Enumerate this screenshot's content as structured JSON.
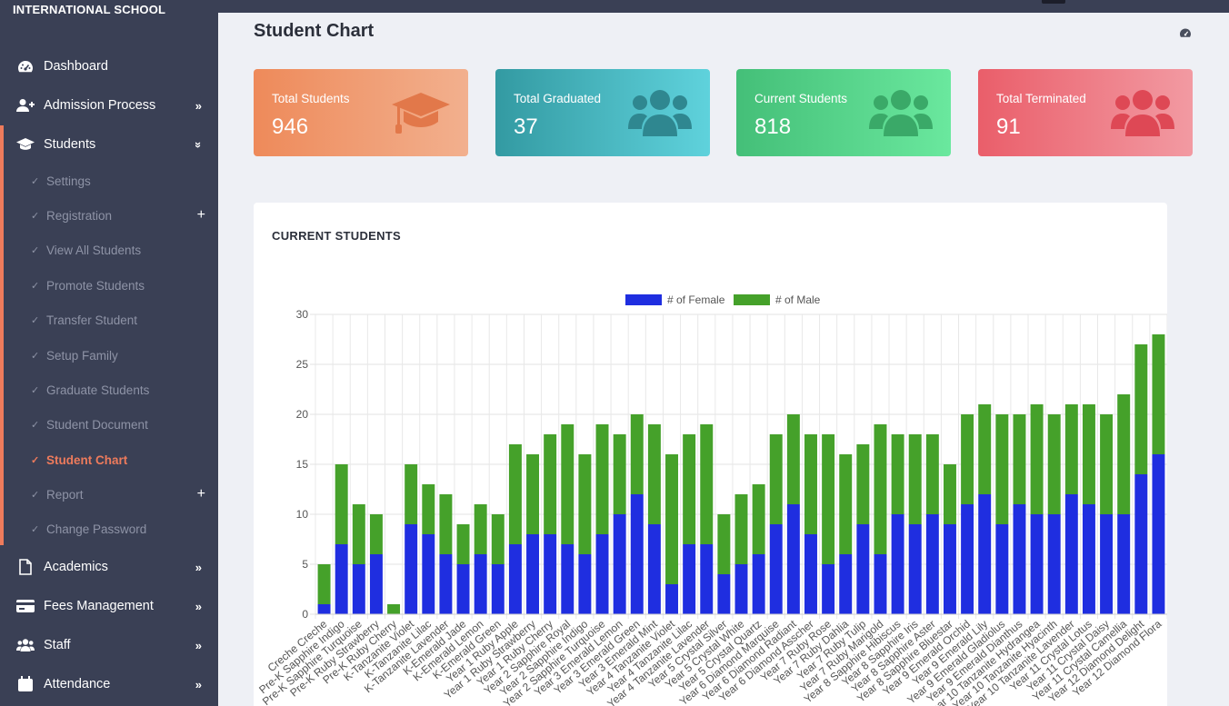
{
  "sidebar": {
    "brand": "INTERNATIONAL SCHOOL",
    "items": {
      "dashboard": {
        "label": "Dashboard",
        "icon": "dashboard-icon"
      },
      "admission": {
        "label": "Admission Process",
        "icon": "user-plus-icon"
      },
      "students": {
        "label": "Students",
        "icon": "graduation-cap-icon"
      },
      "academics": {
        "label": "Academics",
        "icon": "document-icon"
      },
      "fees": {
        "label": "Fees Management",
        "icon": "credit-card-icon"
      },
      "staff": {
        "label": "Staff",
        "icon": "users-icon"
      },
      "attendance": {
        "label": "Attendance",
        "icon": "calendar-icon"
      }
    },
    "students_sub": {
      "settings": "Settings",
      "registration": "Registration",
      "view_all": "View All Students",
      "promote": "Promote Students",
      "transfer": "Transfer Student",
      "family": "Setup Family",
      "graduate": "Graduate Students",
      "document": "Student Document",
      "chart": "Student Chart",
      "report": "Report",
      "password": "Change Password"
    }
  },
  "page": {
    "title": "Student Chart"
  },
  "cards": [
    {
      "label": "Total Students",
      "value": "946",
      "icon": "graduation-cap-icon",
      "color": "#ee8a5a"
    },
    {
      "label": "Total Graduated",
      "value": "37",
      "icon": "users-icon",
      "color": "#339aa2"
    },
    {
      "label": "Current Students",
      "value": "818",
      "icon": "users-icon",
      "color": "#44bf78"
    },
    {
      "label": "Total Terminated",
      "value": "91",
      "icon": "users-icon",
      "color": "#ea5e6a"
    }
  ],
  "chart": {
    "heading": "CURRENT STUDENTS"
  },
  "colors": {
    "sidebar_bg": "#3a4055",
    "accent": "#ee7b5c",
    "female": "#1f2ee0",
    "male": "#45a12a"
  },
  "chart_data": {
    "type": "bar",
    "stacked": true,
    "title": "",
    "xlabel": "",
    "ylabel": "",
    "ylim": [
      0,
      30
    ],
    "yticks": [
      0,
      5,
      10,
      15,
      20,
      25,
      30
    ],
    "grid": true,
    "legend_position": "top",
    "categories": [
      "Creche Creche",
      "Pre-K Sapphire Indigo",
      "Pre-K Sapphire Turquoise",
      "Pre-K Ruby Strawberry",
      "Pre-K Ruby Cherry",
      "K-Tanzanite Violet",
      "K-Tanzanite Lilac",
      "K-Tanzanite Lavender",
      "K-Emerald Jade",
      "K-Emerald Lemon",
      "K-Emerald Green",
      "Year 1 Ruby Apple",
      "Year 1 Ruby Strawberry",
      "Year 1 Ruby Cherry",
      "Year 2 Sapphire Royal",
      "Year 2 Sapphire Indigo",
      "Year 2 Sapphire Turquoise",
      "Year 3 Emerald Lemon",
      "Year 3 Emerald Green",
      "Year 3 Emerald Mint",
      "Year 4 Tanzanite Violet",
      "Year 4 Tanzanite Lilac",
      "Year 4 Tanzanite Lavender",
      "Year 5 Crystal Silver",
      "Year 5 Crystal White",
      "Year 5 Crystal Quartz",
      "Year 6 Diamond Marquise",
      "Year 6 Diamond Radiant",
      "Year 6 Diamond Asscher",
      "Year 7 Ruby Rose",
      "Year 7 Ruby Dahlia",
      "Year 7 Ruby Tulip",
      "Year 7 Ruby Marigold",
      "Year 8 Sapphire Hibiscus",
      "Year 8 Sapphire Iris",
      "Year 8 Sapphire Aster",
      "Year 8 Sapphire Bluestar",
      "Year 9 Emerald Orchid",
      "Year 9 Emerald Lily",
      "Year 9 Emerald Gladiolus",
      "Year 9 Emerald Dianthus",
      "Year 10 Tanzanite Hydrangea",
      "Year 10 Tanzanite Hyacinth",
      "Year 10 Tanzanite Lavender",
      "Year 11 Crystal Lotus",
      "Year 11 Crystal Daisy",
      "Year 11 Crystal Camellia",
      "Year 12 Diamond Delight",
      "Year 12 Diamond Flora"
    ],
    "series": [
      {
        "name": "# of Female",
        "color": "#1f2ee0",
        "values": [
          1,
          7,
          5,
          6,
          0,
          9,
          8,
          6,
          5,
          6,
          5,
          7,
          8,
          8,
          7,
          6,
          8,
          10,
          12,
          9,
          3,
          7,
          7,
          4,
          5,
          6,
          9,
          11,
          8,
          5,
          6,
          9,
          6,
          10,
          9,
          10,
          9,
          11,
          12,
          9,
          11,
          10,
          10,
          12,
          11,
          10,
          10,
          14,
          16
        ]
      },
      {
        "name": "# of Male",
        "color": "#45a12a",
        "values": [
          4,
          8,
          6,
          4,
          1,
          6,
          5,
          6,
          4,
          5,
          5,
          10,
          8,
          10,
          12,
          10,
          11,
          8,
          8,
          10,
          13,
          11,
          12,
          6,
          7,
          7,
          9,
          9,
          10,
          13,
          10,
          8,
          13,
          8,
          9,
          8,
          6,
          9,
          9,
          11,
          9,
          11,
          10,
          9,
          10,
          10,
          12,
          13,
          12
        ]
      }
    ]
  }
}
